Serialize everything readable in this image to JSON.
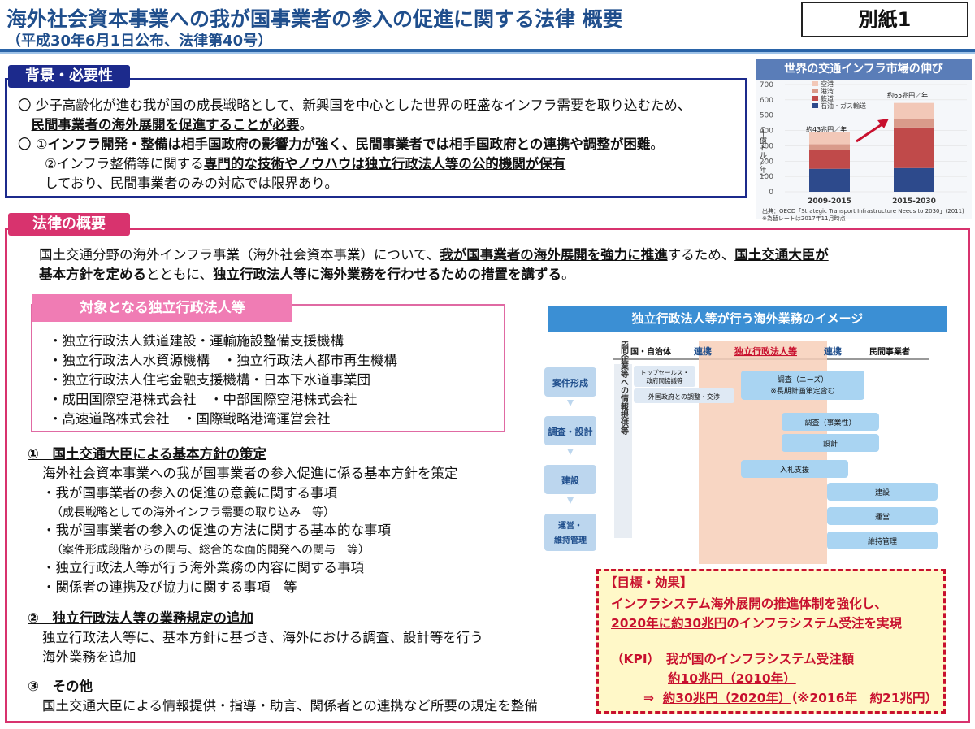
{
  "header": {
    "title": "海外社会資本事業への我が国事業者の参入の促進に関する法律 概要",
    "subtitle": "（平成30年6月1日公布、法律第40号）",
    "stamp": "別紙1"
  },
  "background": {
    "label": "背景・必要性",
    "lines": [
      {
        "pre": "〇 少子高齢化が進む我が国の成長戦略として、新興国を中心とした世界の旺盛なインフラ需要を取り込むため、",
        "em": "",
        "post": ""
      },
      {
        "pre": "　",
        "em": "民間事業者の海外展開を促進することが必要",
        "post": "。"
      },
      {
        "pre": "〇 ①",
        "em": "インフラ開発・整備は相手国政府の影響力が強く、民間事業者では相手国政府との連携や調整が困難",
        "post": "。"
      },
      {
        "pre": "　　②インフラ整備等に関する",
        "em": "専門的な技術やノウハウは独立行政法人等の公的機関が保有",
        "post": ""
      },
      {
        "pre": "　　しており、民間事業者のみの対応では限界あり。",
        "em": "",
        "post": ""
      }
    ]
  },
  "chart": {
    "title": "世界の交通インフラ市場の伸び",
    "ylabel": "（十億ドル／年）",
    "legend": [
      "空港",
      "港湾",
      "鉄道",
      "石油・ガス輸送"
    ],
    "annotations": [
      "約43兆円／年",
      "約65兆円／年"
    ],
    "source_lines": [
      "出典：OECD「Strategic Transport Infrastructure Needs to 2030」(2011)",
      "※為替レートは2017年11月時点"
    ],
    "colors": {
      "airport": "#f2c8b8",
      "port": "#d99a8a",
      "rail": "#c04a4a",
      "oil_gas": "#2d4a8c"
    }
  },
  "chart_data": {
    "type": "bar",
    "title": "世界の交通インフラ市場の伸び",
    "ylabel": "（十億ドル／年）",
    "ylim": [
      0,
      700
    ],
    "yticks": [
      "0",
      "100",
      "200",
      "300",
      "400",
      "500",
      "600",
      "700"
    ],
    "categories": [
      "2009-2015",
      "2015-2030"
    ],
    "series": [
      {
        "name": "石油・ガス輸送",
        "values": [
          150,
          155
        ]
      },
      {
        "name": "鉄道",
        "values": [
          125,
          265
        ]
      },
      {
        "name": "港湾",
        "values": [
          35,
          55
        ]
      },
      {
        "name": "空港",
        "values": [
          80,
          105
        ]
      }
    ]
  },
  "law": {
    "label": "法律の概要",
    "intro": [
      {
        "a": "国土交通分野の海外インフラ事業（海外社会資本事業）について、",
        "b": "我が国事業者の海外展開を強力に推進",
        "c": "するため、",
        "d": "国土交通大臣が"
      },
      {
        "a": "",
        "b": "基本方針を定める",
        "c": "とともに、",
        "d": "独立行政法人等に海外業務を行わせるための措置を講ずる",
        "e": "。"
      }
    ],
    "target_label": "対象となる独立行政法人等",
    "targets": [
      "・独立行政法人鉄道建設・運輸施設整備支援機構",
      "・独立行政法人水資源機構　・独立行政法人都市再生機構",
      "・独立行政法人住宅金融支援機構・日本下水道事業団",
      "・成田国際空港株式会社　・中部国際空港株式会社",
      "・高速道路株式会社　・国際戦略港湾運営会社"
    ],
    "sections": [
      {
        "heading": "①　国土交通大臣による基本方針の策定",
        "lines": [
          {
            "t": "海外社会資本事業への我が国事業者の参入促進に係る基本方針を策定",
            "small": false
          },
          {
            "t": "・我が国事業者の参入の促進の意義に関する事項",
            "small": false
          },
          {
            "t": "　（成長戦略としての海外インフラ需要の取り込み　等）",
            "small": true
          },
          {
            "t": "・我が国事業者の参入の促進の方法に関する基本的な事項",
            "small": false
          },
          {
            "t": "　（案件形成段階からの関与、総合的な面的開発への関与　等）",
            "small": true
          },
          {
            "t": "・独立行政法人等が行う海外業務の内容に関する事項",
            "small": false
          },
          {
            "t": "・関係者の連携及び協力に関する事項　等",
            "small": false
          }
        ]
      },
      {
        "heading": "②　独立行政法人等の業務規定の追加",
        "lines": [
          {
            "t": "独立行政法人等に、基本方針に基づき、海外における調査、設計等を行う",
            "small": false
          },
          {
            "t": "海外業務を追加",
            "small": false
          }
        ]
      },
      {
        "heading": "③　その他",
        "lines": [
          {
            "t": "国土交通大臣による情報提供・指導・助言、関係者との連携など所要の規定を整備",
            "small": false
          }
        ]
      }
    ]
  },
  "image": {
    "title": "独立行政法人等が行う海外業務のイメージ",
    "columns": [
      "国・自治体",
      "連携",
      "独立行政法人等",
      "連携",
      "民間事業者"
    ],
    "phases": [
      "案件形成",
      "調査・設計",
      "建設",
      "運営・\n維持管理"
    ],
    "side_label": "機構・民間企業等への情報提供等",
    "tasks": {
      "top_sales": "トップセールス・\n政府間協議等",
      "gov_coord": "外国政府との調整・交渉",
      "needs_survey": "調査（ニーズ）\n※長期計画策定含む",
      "biz_survey": "調査（事業性）",
      "design": "設計",
      "bid": "入札支援",
      "construction": "建設",
      "operation": "運営",
      "maintenance": "維持管理"
    }
  },
  "goal": {
    "heading": "【目標・効果】",
    "l1": "インフラシステム海外展開の推進体制を強化し、",
    "l2a": "2020年に約30兆円",
    "l2b": "のインフラシステム受注を実現",
    "kpi_label": "（KPI）　我が国のインフラシステム受注額",
    "kpi1": "約10兆円（2010年）",
    "kpi2_arrow": "⇒",
    "kpi2": "約30兆円（2020年）",
    "kpi2_note": "（※2016年　約21兆円）"
  }
}
